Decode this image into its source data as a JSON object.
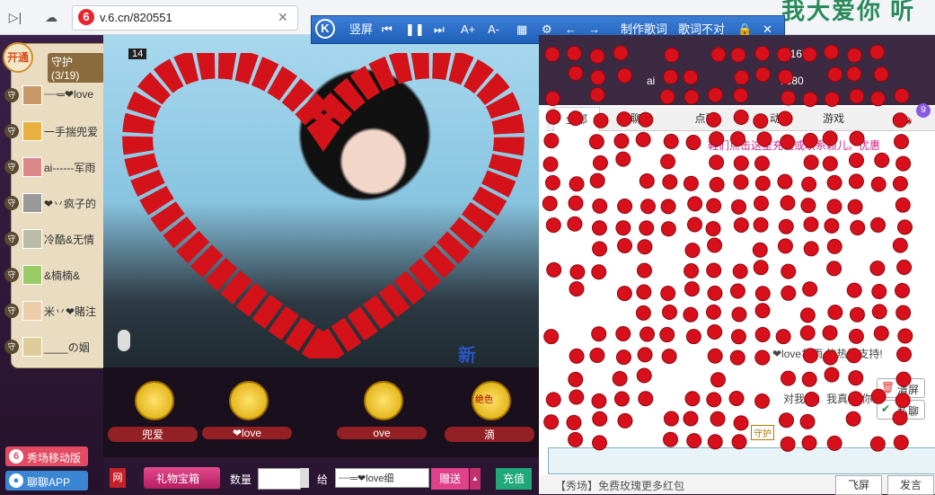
{
  "browser": {
    "url": "v.6.cn/820551",
    "back_icon": "play-forward-icon",
    "cloud_icon": "cloud-icon",
    "site_logo": "6",
    "banner_text": "我大爱你 听"
  },
  "lyrics_toolbar": {
    "logo": "K",
    "portrait": "竖屏",
    "make_lyrics": "制作歌词",
    "wrong_lyrics": "歌词不对",
    "icons": [
      "previous-icon",
      "pause-icon",
      "next-icon",
      "font-bigger-icon",
      "font-smaller-icon",
      "color-icon",
      "settings-icon",
      "back-arrow-icon",
      "forward-arrow-icon",
      "lock-icon",
      "close-icon"
    ],
    "font_bigger": "A+",
    "font_smaller": "A-",
    "close": "✕"
  },
  "guard": {
    "open_label": "开通",
    "title": "守护(3/19)",
    "badge": "守",
    "members": [
      "┈┈═❤love",
      "一手揣兜爱",
      "ai------军雨",
      "❤丷疯子的",
      "冷酷&无情",
      "&楠楠&",
      "米丷❤賭注",
      "____の姻"
    ]
  },
  "sidebar_buttons": {
    "mobile": "秀场移动版",
    "app": "聊聊APP"
  },
  "video": {
    "cam_number": "14",
    "overlay_text": "新 "
  },
  "gifts": [
    {
      "name": "兜爱",
      "tag": ""
    },
    {
      "name": "❤love",
      "tag": ""
    },
    {
      "name": "ove",
      "tag": ""
    },
    {
      "name": "滴",
      "tag": "绝色"
    }
  ],
  "controls": {
    "gift_box": "礼物宝箱",
    "qty_label": "数量",
    "to_label": "给",
    "to_value": "┈┈═❤love细",
    "send": "赠送",
    "recharge": "充值"
  },
  "ranking": [
    {
      "num": "",
      "value": "11165"
    },
    {
      "num": "2",
      "name": "ai",
      "value": "7680"
    }
  ],
  "tabs": [
    "全部",
    "聊",
    "点歌",
    "动",
    "游戏"
  ],
  "car_badge": "9",
  "chat": {
    "notice": "鞋们点击这里充值或联系颖儿。优惠",
    "thanks": "❤love华雨 的热情支持!",
    "reply": "对我说：我真诚 你会",
    "clear": "清屏",
    "private": "私聊",
    "guard_tag": "守护"
  },
  "footer": {
    "promo": "【秀场】免费玫瑰更多红包",
    "fly": "飞屏",
    "say": "发言"
  }
}
